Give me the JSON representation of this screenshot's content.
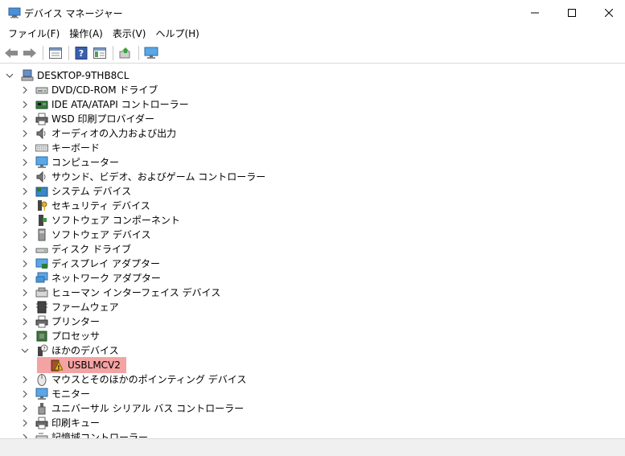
{
  "window": {
    "title": "デバイス マネージャー",
    "controls": {
      "minimize": "─",
      "maximize": "☐",
      "close": "✕"
    }
  },
  "menu": [
    "ファイル(F)",
    "操作(A)",
    "表示(V)",
    "ヘルプ(H)"
  ],
  "toolbar": [
    "back-icon",
    "forward-icon",
    "properties-icon",
    "help-icon",
    "view-icon",
    "update-driver-icon",
    "scan-hardware-icon"
  ],
  "tree": {
    "root": "DESKTOP-9THB8CL",
    "categories": [
      {
        "label": "DVD/CD-ROM ドライブ",
        "icon": "dvd-drive-icon"
      },
      {
        "label": "IDE ATA/ATAPI コントローラー",
        "icon": "ide-controller-icon"
      },
      {
        "label": "WSD 印刷プロバイダー",
        "icon": "printer-icon"
      },
      {
        "label": "オーディオの入力および出力",
        "icon": "speaker-icon"
      },
      {
        "label": "キーボード",
        "icon": "keyboard-icon"
      },
      {
        "label": "コンピューター",
        "icon": "computer-icon"
      },
      {
        "label": "サウンド、ビデオ、およびゲーム コントローラー",
        "icon": "speaker-icon"
      },
      {
        "label": "システム デバイス",
        "icon": "system-device-icon"
      },
      {
        "label": "セキュリティ デバイス",
        "icon": "security-key-icon"
      },
      {
        "label": "ソフトウェア コンポーネント",
        "icon": "software-component-icon"
      },
      {
        "label": "ソフトウェア デバイス",
        "icon": "software-device-icon"
      },
      {
        "label": "ディスク ドライブ",
        "icon": "disk-drive-icon"
      },
      {
        "label": "ディスプレイ アダプター",
        "icon": "display-adapter-icon"
      },
      {
        "label": "ネットワーク アダプター",
        "icon": "network-adapter-icon"
      },
      {
        "label": "ヒューマン インターフェイス デバイス",
        "icon": "hid-icon"
      },
      {
        "label": "ファームウェア",
        "icon": "firmware-icon"
      },
      {
        "label": "プリンター",
        "icon": "printer-icon"
      },
      {
        "label": "プロセッサ",
        "icon": "processor-icon"
      }
    ],
    "expanded": {
      "label": "ほかのデバイス",
      "icon": "unknown-device-icon",
      "children": [
        {
          "label": "USBLMCV2",
          "icon": "warning-device-icon",
          "highlight_color": "#f4a3a3"
        }
      ]
    },
    "categories_after": [
      {
        "label": "マウスとそのほかのポインティング デバイス",
        "icon": "mouse-icon"
      },
      {
        "label": "モニター",
        "icon": "monitor-icon"
      },
      {
        "label": "ユニバーサル シリアル バス コントローラー",
        "icon": "usb-icon"
      },
      {
        "label": "印刷キュー",
        "icon": "print-queue-icon"
      },
      {
        "label": "記憶域コントローラー",
        "icon": "storage-controller-icon"
      }
    ]
  }
}
